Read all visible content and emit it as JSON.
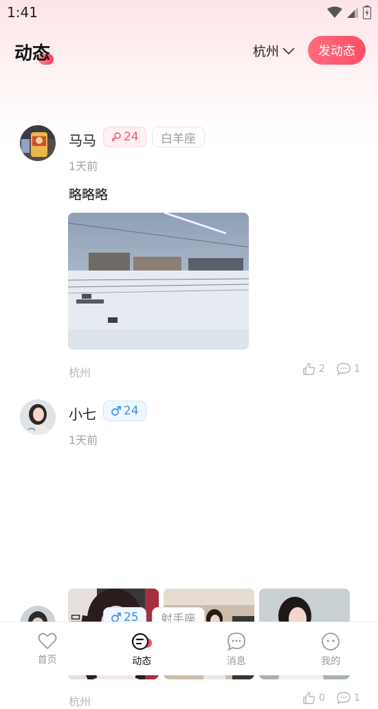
{
  "status_bar": {
    "time": "1:41",
    "icons": [
      "wifi-icon",
      "signal-icon",
      "battery-icon"
    ]
  },
  "header": {
    "title": "动态",
    "city": "杭州",
    "post_button": "发动态"
  },
  "posts": [
    {
      "username": "马马",
      "gender": "female",
      "age": "24",
      "zodiac": "白羊座",
      "time": "1天前",
      "text": "略略略",
      "photos": [
        "winter-railway-photo"
      ],
      "location": "杭州",
      "likes": "2",
      "comments": "1"
    },
    {
      "username": "小七",
      "gender": "male",
      "age": "24",
      "zodiac": "",
      "time": "1天前",
      "text": "",
      "photos": [
        "girl-selfie-photo",
        "girl-certificate-photo",
        "girl-lakeside-photo"
      ],
      "location": "杭州",
      "likes": "0",
      "comments": "1"
    },
    {
      "username": "吕布",
      "gender": "male",
      "age": "25",
      "zodiac": "射手座"
    }
  ],
  "bottom_nav": [
    {
      "label": "首页",
      "icon": "heart-icon",
      "active": false
    },
    {
      "label": "动态",
      "icon": "moments-icon",
      "active": true
    },
    {
      "label": "消息",
      "icon": "chat-icon",
      "active": false
    },
    {
      "label": "我的",
      "icon": "face-icon",
      "active": false
    }
  ],
  "colors": {
    "accent": "#ff4e66",
    "female": "#f3556b",
    "male": "#3b8fe6"
  }
}
